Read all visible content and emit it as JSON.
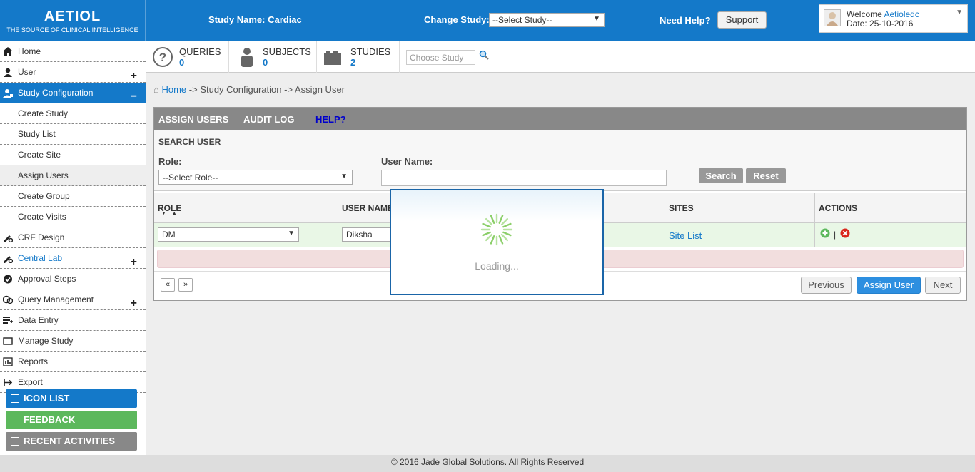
{
  "header": {
    "logo_name": "AETIOL",
    "logo_tagline": "THE SOURCE OF CLINICAL INTELLIGENCE",
    "study_name": "Study Name: Cardiac",
    "change_study_label": "Change Study:",
    "change_study_value": "--Select Study--",
    "need_help": "Need Help?",
    "support_label": "Support",
    "welcome_prefix": "Welcome",
    "username": "Aetioledc",
    "date": "Date: 25-10-2016"
  },
  "sidebar": {
    "items": [
      {
        "label": "Home"
      },
      {
        "label": "User"
      },
      {
        "label": "Study Configuration"
      },
      {
        "label": "Create Study"
      },
      {
        "label": "Study List"
      },
      {
        "label": "Create Site"
      },
      {
        "label": "Assign Users"
      },
      {
        "label": "Create Group"
      },
      {
        "label": "Create Visits"
      },
      {
        "label": "CRF Design"
      },
      {
        "label": "Central Lab"
      },
      {
        "label": "Approval Steps"
      },
      {
        "label": "Query Management"
      },
      {
        "label": "Data Entry"
      },
      {
        "label": "Manage Study"
      },
      {
        "label": "Reports"
      },
      {
        "label": "Export"
      }
    ],
    "icon_list": "ICON LIST",
    "feedback": "FEEDBACK",
    "recent_activities": "RECENT ACTIVITIES"
  },
  "stats": {
    "queries_label": "QUERIES",
    "queries_count": "0",
    "subjects_label": "SUBJECTS",
    "subjects_count": "0",
    "studies_label": "STUDIES",
    "studies_count": "2",
    "choose_placeholder": "Choose Study"
  },
  "breadcrumb": {
    "home": "Home",
    "rest": " -> Study Configuration -> Assign User"
  },
  "panel": {
    "tabs": [
      "ASSIGN USERS",
      "AUDIT LOG",
      "HELP?"
    ],
    "search_title": "SEARCH USER",
    "role_label": "Role:",
    "role_value": "--Select Role--",
    "username_label": "User Name:",
    "search_btn": "Search",
    "reset_btn": "Reset"
  },
  "table": {
    "headers": [
      "ROLE",
      "USER NAME",
      "SITES",
      "ACTIONS"
    ],
    "row": {
      "role": "DM",
      "username": "Diksha",
      "sites": "Site List"
    }
  },
  "pager": {
    "first": "«",
    "last": "»",
    "previous": "Previous",
    "assign": "Assign User",
    "next": "Next"
  },
  "loading": {
    "text": "Loading..."
  },
  "footer": {
    "text": "© 2016 Jade Global Solutions. All Rights Reserved"
  },
  "colors": {
    "brand_blue": "#1479c9",
    "feedback_green": "#5cb85c",
    "recent_gray": "#888888",
    "row_green": "#e9f7e6",
    "alert_pink": "#f2dede"
  }
}
